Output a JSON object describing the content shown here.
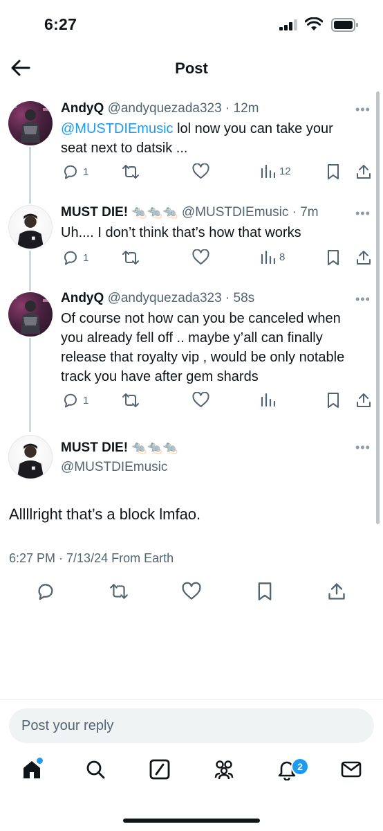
{
  "status_bar": {
    "time": "6:27"
  },
  "header": {
    "title": "Post"
  },
  "thread": [
    {
      "name": "AndyQ",
      "handle": "@andyquezada323",
      "time": "12m",
      "mention": "@MUSTDIEmusic",
      "text_line1_after_mention": " lol now you can take your",
      "text_line2": "seat next to datsik ...",
      "replies": "1",
      "views": "12"
    },
    {
      "name": "MUST DIE!",
      "rats": "🐀🐀🐀",
      "handle": "@MUSTDIEmusic",
      "time": "7m",
      "text": "Uh.... I don’t think that’s how that works",
      "replies": "1",
      "views": "8"
    },
    {
      "name": "AndyQ",
      "handle": "@andyquezada323",
      "time": "58s",
      "lines": [
        "Of course not how can you be canceled when",
        "you already fell off .. maybe y’all can finally",
        "release that royalty vip , would be only notable",
        "track you have after gem shards"
      ],
      "replies": "1"
    }
  ],
  "main_post": {
    "name": "MUST DIE!",
    "rats": "🐀🐀🐀",
    "handle": "@MUSTDIEmusic",
    "text": "Allllright that’s a block lmfao.",
    "meta": "6:27 PM · 7/13/24 From Earth"
  },
  "reply": {
    "placeholder": "Post your reply"
  },
  "tabs": {
    "items": [
      "home-icon",
      "search-icon",
      "grok-icon",
      "communities-icon",
      "notifications-icon",
      "messages-icon"
    ],
    "notification_count": "2"
  },
  "colors": {
    "accent": "#1d9bf0",
    "secondary_text": "#536471",
    "thread_line": "#cfd9de"
  }
}
